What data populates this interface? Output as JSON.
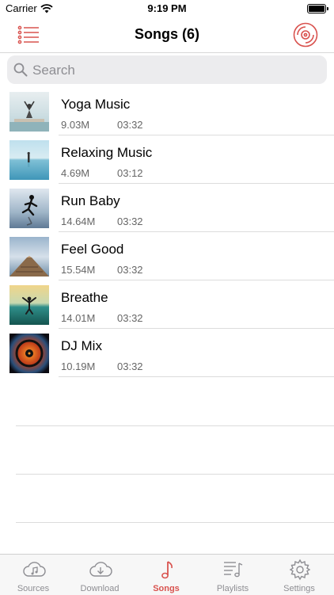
{
  "status_bar": {
    "carrier": "Carrier",
    "time": "9:19 PM"
  },
  "nav": {
    "title": "Songs (6)",
    "left_icon": "list-icon",
    "right_icon": "vinyl-disc-icon"
  },
  "search": {
    "placeholder": "Search"
  },
  "songs": [
    {
      "title": "Yoga Music",
      "size": "9.03M",
      "duration": "03:32"
    },
    {
      "title": "Relaxing Music",
      "size": "4.69M",
      "duration": "03:12"
    },
    {
      "title": "Run Baby",
      "size": "14.64M",
      "duration": "03:32"
    },
    {
      "title": "Feel Good",
      "size": "15.54M",
      "duration": "03:32"
    },
    {
      "title": "Breathe",
      "size": "14.01M",
      "duration": "03:32"
    },
    {
      "title": "DJ Mix",
      "size": "10.19M",
      "duration": "03:32"
    }
  ],
  "tabs": [
    {
      "label": "Sources",
      "icon": "cloud-music-icon"
    },
    {
      "label": "Download",
      "icon": "cloud-download-icon"
    },
    {
      "label": "Songs",
      "icon": "music-note-icon"
    },
    {
      "label": "Playlists",
      "icon": "playlist-icon"
    },
    {
      "label": "Settings",
      "icon": "gear-icon"
    }
  ],
  "active_tab": "Songs",
  "colors": {
    "accent": "#d9534f",
    "inactive": "#8e8e93"
  }
}
